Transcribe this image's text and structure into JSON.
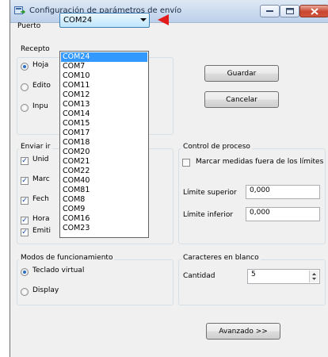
{
  "window": {
    "title": "Configuración de parámetros de envío"
  },
  "port": {
    "label": "Puerto",
    "selected": "COM24",
    "options": [
      "COM24",
      "COM7",
      "COM10",
      "COM11",
      "COM12",
      "COM13",
      "COM14",
      "COM15",
      "COM17",
      "COM18",
      "COM20",
      "COM21",
      "COM22",
      "COM40",
      "COM81",
      "COM8",
      "COM9",
      "COM16",
      "COM23"
    ],
    "arrow_color": "#e21b1b"
  },
  "receptor": {
    "title_visible": "Recepto",
    "options_visible": [
      "Hoja",
      "Edito",
      "Inpu"
    ],
    "selected_index": 0
  },
  "send_info": {
    "title_visible": "Enviar ir",
    "options_visible": [
      "Unid",
      "Marc",
      "Fech",
      "Hora",
      "Emiti"
    ]
  },
  "buttons": {
    "save": "Guardar",
    "cancel": "Cancelar",
    "advanced": "Avanzado >>"
  },
  "process": {
    "title": "Control de proceso",
    "check_label": "Marcar medidas fuera de los límites",
    "upper_label": "Límite superior",
    "upper_value": "0,000",
    "lower_label": "Límite inferior",
    "lower_value": "0,000"
  },
  "modes": {
    "title": "Modos de funcionamiento",
    "options": [
      "Teclado virtual",
      "Display"
    ],
    "selected_index": 0
  },
  "blank_chars": {
    "title": "Caracteres en blanco",
    "quantity_label": "Cantidad",
    "quantity_value": "5"
  }
}
